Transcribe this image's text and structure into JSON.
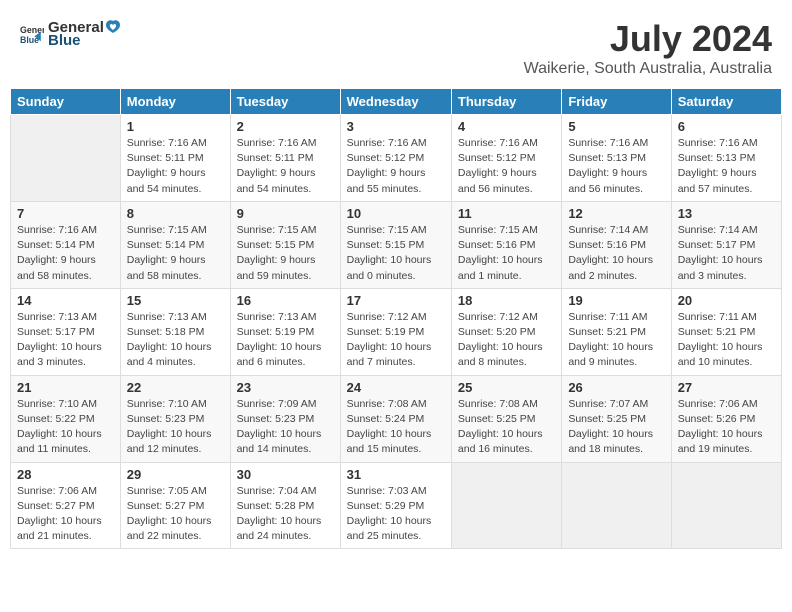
{
  "header": {
    "logo_general": "General",
    "logo_blue": "Blue",
    "title": "July 2024",
    "subtitle": "Waikerie, South Australia, Australia"
  },
  "days_of_week": [
    "Sunday",
    "Monday",
    "Tuesday",
    "Wednesday",
    "Thursday",
    "Friday",
    "Saturday"
  ],
  "weeks": [
    [
      {
        "day": "",
        "info": ""
      },
      {
        "day": "1",
        "info": "Sunrise: 7:16 AM\nSunset: 5:11 PM\nDaylight: 9 hours\nand 54 minutes."
      },
      {
        "day": "2",
        "info": "Sunrise: 7:16 AM\nSunset: 5:11 PM\nDaylight: 9 hours\nand 54 minutes."
      },
      {
        "day": "3",
        "info": "Sunrise: 7:16 AM\nSunset: 5:12 PM\nDaylight: 9 hours\nand 55 minutes."
      },
      {
        "day": "4",
        "info": "Sunrise: 7:16 AM\nSunset: 5:12 PM\nDaylight: 9 hours\nand 56 minutes."
      },
      {
        "day": "5",
        "info": "Sunrise: 7:16 AM\nSunset: 5:13 PM\nDaylight: 9 hours\nand 56 minutes."
      },
      {
        "day": "6",
        "info": "Sunrise: 7:16 AM\nSunset: 5:13 PM\nDaylight: 9 hours\nand 57 minutes."
      }
    ],
    [
      {
        "day": "7",
        "info": "Sunrise: 7:16 AM\nSunset: 5:14 PM\nDaylight: 9 hours\nand 58 minutes."
      },
      {
        "day": "8",
        "info": "Sunrise: 7:15 AM\nSunset: 5:14 PM\nDaylight: 9 hours\nand 58 minutes."
      },
      {
        "day": "9",
        "info": "Sunrise: 7:15 AM\nSunset: 5:15 PM\nDaylight: 9 hours\nand 59 minutes."
      },
      {
        "day": "10",
        "info": "Sunrise: 7:15 AM\nSunset: 5:15 PM\nDaylight: 10 hours\nand 0 minutes."
      },
      {
        "day": "11",
        "info": "Sunrise: 7:15 AM\nSunset: 5:16 PM\nDaylight: 10 hours\nand 1 minute."
      },
      {
        "day": "12",
        "info": "Sunrise: 7:14 AM\nSunset: 5:16 PM\nDaylight: 10 hours\nand 2 minutes."
      },
      {
        "day": "13",
        "info": "Sunrise: 7:14 AM\nSunset: 5:17 PM\nDaylight: 10 hours\nand 3 minutes."
      }
    ],
    [
      {
        "day": "14",
        "info": "Sunrise: 7:13 AM\nSunset: 5:17 PM\nDaylight: 10 hours\nand 3 minutes."
      },
      {
        "day": "15",
        "info": "Sunrise: 7:13 AM\nSunset: 5:18 PM\nDaylight: 10 hours\nand 4 minutes."
      },
      {
        "day": "16",
        "info": "Sunrise: 7:13 AM\nSunset: 5:19 PM\nDaylight: 10 hours\nand 6 minutes."
      },
      {
        "day": "17",
        "info": "Sunrise: 7:12 AM\nSunset: 5:19 PM\nDaylight: 10 hours\nand 7 minutes."
      },
      {
        "day": "18",
        "info": "Sunrise: 7:12 AM\nSunset: 5:20 PM\nDaylight: 10 hours\nand 8 minutes."
      },
      {
        "day": "19",
        "info": "Sunrise: 7:11 AM\nSunset: 5:21 PM\nDaylight: 10 hours\nand 9 minutes."
      },
      {
        "day": "20",
        "info": "Sunrise: 7:11 AM\nSunset: 5:21 PM\nDaylight: 10 hours\nand 10 minutes."
      }
    ],
    [
      {
        "day": "21",
        "info": "Sunrise: 7:10 AM\nSunset: 5:22 PM\nDaylight: 10 hours\nand 11 minutes."
      },
      {
        "day": "22",
        "info": "Sunrise: 7:10 AM\nSunset: 5:23 PM\nDaylight: 10 hours\nand 12 minutes."
      },
      {
        "day": "23",
        "info": "Sunrise: 7:09 AM\nSunset: 5:23 PM\nDaylight: 10 hours\nand 14 minutes."
      },
      {
        "day": "24",
        "info": "Sunrise: 7:08 AM\nSunset: 5:24 PM\nDaylight: 10 hours\nand 15 minutes."
      },
      {
        "day": "25",
        "info": "Sunrise: 7:08 AM\nSunset: 5:25 PM\nDaylight: 10 hours\nand 16 minutes."
      },
      {
        "day": "26",
        "info": "Sunrise: 7:07 AM\nSunset: 5:25 PM\nDaylight: 10 hours\nand 18 minutes."
      },
      {
        "day": "27",
        "info": "Sunrise: 7:06 AM\nSunset: 5:26 PM\nDaylight: 10 hours\nand 19 minutes."
      }
    ],
    [
      {
        "day": "28",
        "info": "Sunrise: 7:06 AM\nSunset: 5:27 PM\nDaylight: 10 hours\nand 21 minutes."
      },
      {
        "day": "29",
        "info": "Sunrise: 7:05 AM\nSunset: 5:27 PM\nDaylight: 10 hours\nand 22 minutes."
      },
      {
        "day": "30",
        "info": "Sunrise: 7:04 AM\nSunset: 5:28 PM\nDaylight: 10 hours\nand 24 minutes."
      },
      {
        "day": "31",
        "info": "Sunrise: 7:03 AM\nSunset: 5:29 PM\nDaylight: 10 hours\nand 25 minutes."
      },
      {
        "day": "",
        "info": ""
      },
      {
        "day": "",
        "info": ""
      },
      {
        "day": "",
        "info": ""
      }
    ]
  ]
}
